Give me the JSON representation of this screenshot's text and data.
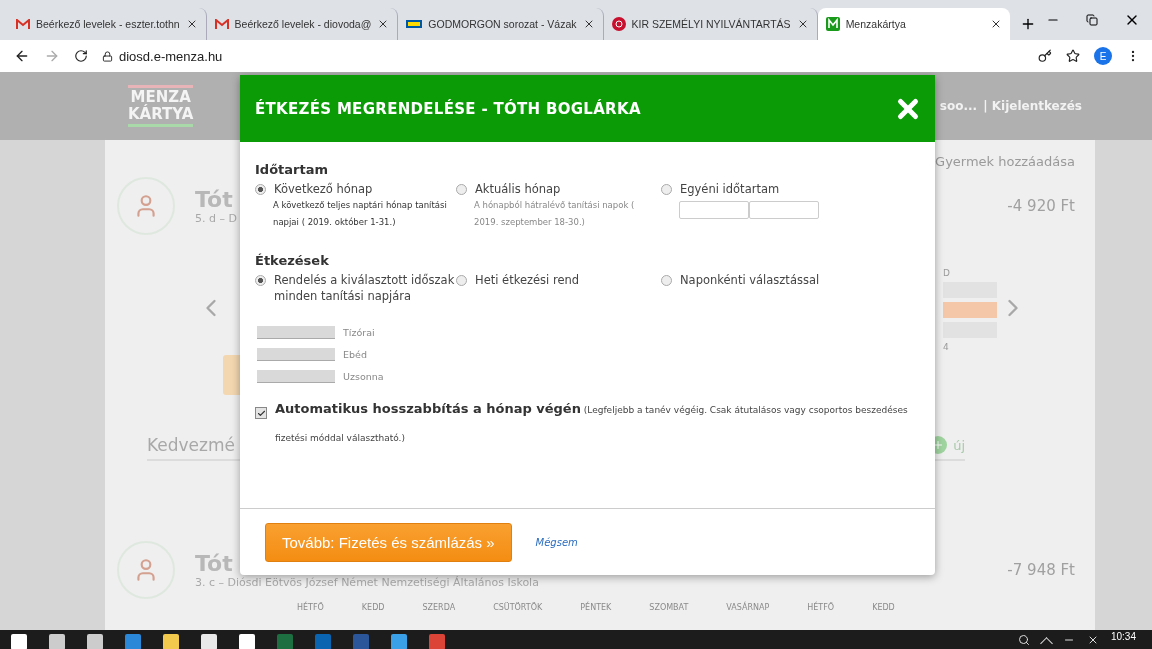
{
  "browser": {
    "tabs": [
      {
        "title": "Beérkező levelek - eszter.tothn",
        "selected": false
      },
      {
        "title": "Beérkező levelek - diovoda@",
        "selected": false
      },
      {
        "title": "GODMORGON sorozat - Vázak",
        "selected": false
      },
      {
        "title": "KIR SZEMÉLYI NYILVÁNTARTÁS",
        "selected": false
      },
      {
        "title": "Menzakártya",
        "selected": true
      }
    ],
    "url": "diosd.e-menza.hu",
    "profile": "E"
  },
  "page": {
    "logo": {
      "line_1": "MENZA",
      "line_2": "KÁRTYA"
    },
    "user_menu": "soo...",
    "logout": "| Kijelentkezés",
    "add_child": "Gyermek hozzáadása",
    "children": [
      {
        "name": "Tót",
        "class": "5. d – D",
        "balance": "-4 920 Ft"
      },
      {
        "name": "Tót",
        "class": "3. c – Diósdi Eötvös József Német Nemzetiségi Általános Iskola",
        "balance": "-7 948 Ft",
        "days": [
          "HÉTFŐ",
          "KEDD",
          "SZERDA",
          "CSÜTÖRTÖK",
          "PÉNTEK",
          "SZOMBAT",
          "VASÁRNAP",
          "HÉTFŐ",
          "KEDD"
        ]
      }
    ],
    "calendar_fragment": {
      "column_1": "D",
      "column_2": "4"
    },
    "discount_label": "Kedvezmé",
    "new_label": "új"
  },
  "dialog": {
    "title": "ÉTKEZÉS MEGRENDELÉSE - TÓTH BOGLÁRKA",
    "sections": [
      {
        "heading": "Időtartam",
        "options": [
          {
            "kind": "text",
            "label": "Következő hónap",
            "description": "A következő teljes naptári hónap tanítási napjai ( 2019. október 1-31.)",
            "selected": true
          },
          {
            "kind": "text",
            "label": "Aktuális hónap",
            "description": "A hónapból hátralévő tanítási napok ( 2019. szeptember 18-30.)",
            "selected": false
          },
          {
            "kind": "date_range",
            "label": "Egyéni időtartam",
            "selected": false
          }
        ]
      },
      {
        "heading": "Étkezések",
        "options": [
          {
            "kind": "text",
            "label": "Rendelés a kiválasztott időszak minden tanítási napjára",
            "selected": true
          },
          {
            "kind": "text",
            "label": "Heti étkezési rend",
            "selected": false
          },
          {
            "kind": "text",
            "label": "Naponkénti választással",
            "selected": false
          }
        ]
      }
    ],
    "meals": [
      "Tízórai",
      "Ebéd",
      "Uzsonna"
    ],
    "auto_renew": {
      "checked": true,
      "text": "**Automatikus hosszabbítás a hónap végén** (Legfeljebb a tanév végéig. Csak átutalásos vagy csoportos beszedéses fizetési móddal választható.)"
    },
    "continue_button": "Tovább: Fizetés és számlázás »",
    "cancel_link": "Mégsem"
  },
  "taskbar": {
    "time": "10:34"
  }
}
